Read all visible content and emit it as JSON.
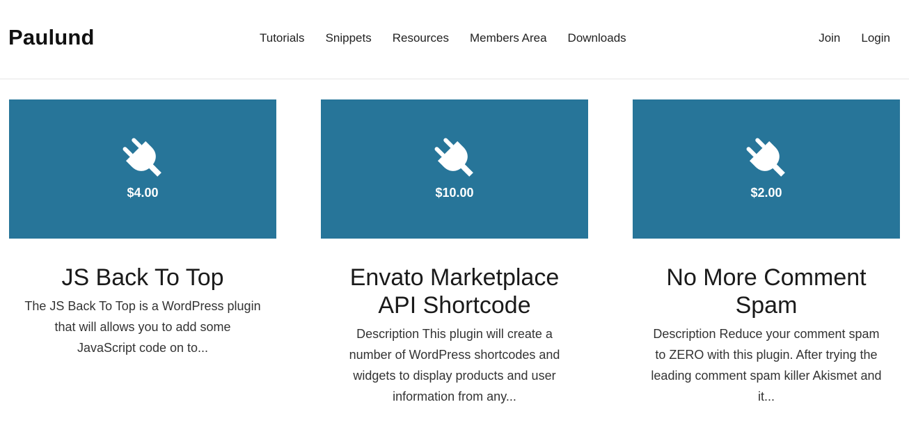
{
  "site": {
    "logo": "Paulund"
  },
  "nav": {
    "main": [
      "Tutorials",
      "Snippets",
      "Resources",
      "Members Area",
      "Downloads"
    ],
    "user": [
      "Join",
      "Login"
    ]
  },
  "colors": {
    "card_bg": "#277599",
    "text": "#222222"
  },
  "products": [
    {
      "icon": "plug-icon",
      "price": "$4.00",
      "title": "JS Back To Top",
      "description": "The JS Back To Top is a WordPress plugin that will allows you to add some JavaScript code on to..."
    },
    {
      "icon": "plug-icon",
      "price": "$10.00",
      "title": "Envato Marketplace API Shortcode",
      "description": "Description This plugin will create a number of WordPress shortcodes and widgets to display products and user information from any..."
    },
    {
      "icon": "plug-icon",
      "price": "$2.00",
      "title": "No More Comment Spam",
      "description": "Description Reduce your comment spam to ZERO with this plugin. After trying the leading comment spam killer Akismet and it..."
    }
  ]
}
